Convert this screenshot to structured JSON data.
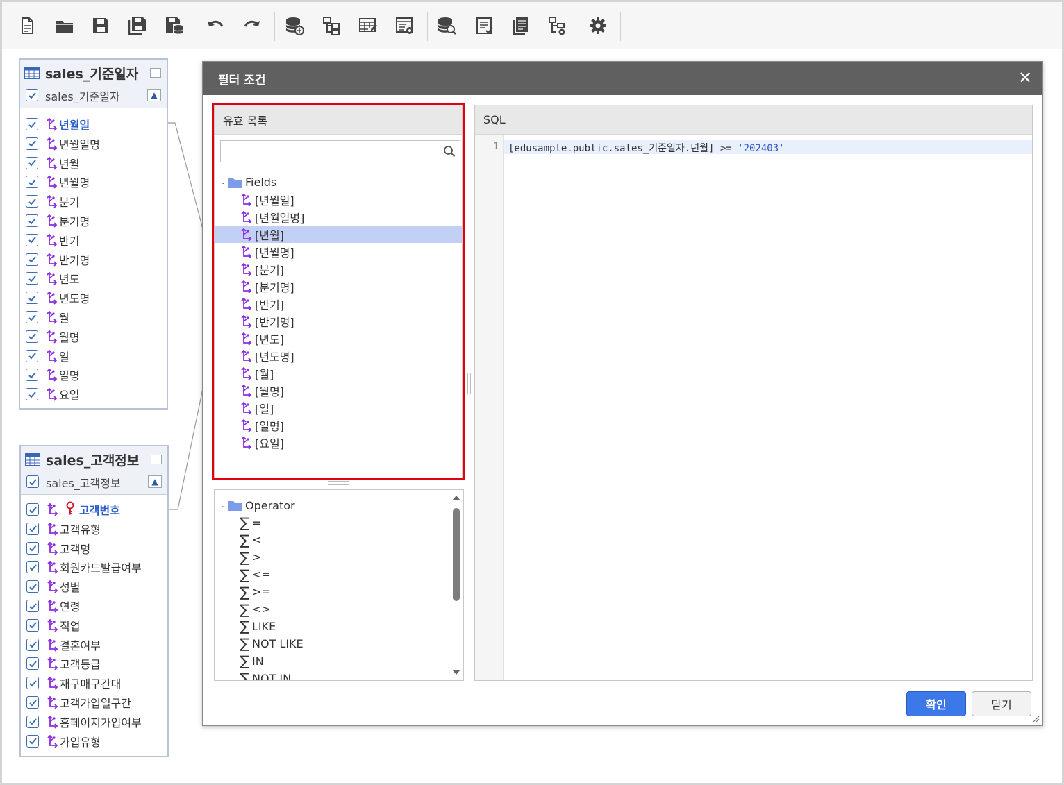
{
  "toolbar": {
    "buttons": [
      "new-document-icon",
      "open-folder-icon",
      "save-icon",
      "save-as-icon",
      "save-db-icon",
      "undo-icon",
      "redo-icon",
      "datasource-icon",
      "schema-icon",
      "table-edit-icon",
      "table-settings-icon",
      "db-search-icon",
      "query-list-icon",
      "report-icon",
      "tree-settings-icon",
      "gear-icon"
    ]
  },
  "table1": {
    "title": "sales_기준일자",
    "subtitle": "sales_기준일자",
    "fields": [
      "년월일",
      "년월일명",
      "년월",
      "년월명",
      "분기",
      "분기명",
      "반기",
      "반기명",
      "년도",
      "년도명",
      "월",
      "월명",
      "일",
      "일명",
      "요일"
    ]
  },
  "table2": {
    "title": "sales_고객정보",
    "subtitle": "sales_고객정보",
    "fields": [
      "고객번호",
      "고객유형",
      "고객명",
      "회원카드발급여부",
      "성별",
      "연령",
      "직업",
      "결혼여부",
      "고객등급",
      "재구매구간대",
      "고객가입일구간",
      "홈페이지가입여부",
      "가입유형"
    ]
  },
  "dialog": {
    "title": "필터 조건",
    "valid_list": {
      "header": "유효 목록",
      "search_placeholder": "",
      "folder": "Fields",
      "items": [
        "[년월일]",
        "[년월일명]",
        "[년월]",
        "[년월명]",
        "[분기]",
        "[분기명]",
        "[반기]",
        "[반기명]",
        "[년도]",
        "[년도명]",
        "[월]",
        "[월명]",
        "[일]",
        "[일명]",
        "[요일]"
      ],
      "selected": "[년월]"
    },
    "operator": {
      "folder": "Operator",
      "items": [
        "=",
        "<",
        ">",
        "<=",
        ">=",
        "<>",
        "LIKE",
        "NOT LIKE",
        "IN",
        "NOT IN"
      ]
    },
    "sql": {
      "header": "SQL",
      "line_number": "1",
      "code_prefix": "[edusample.public.sales_기준일자.년월] >= ",
      "code_string": "'202403'"
    },
    "ok_label": "확인",
    "close_label": "닫기"
  },
  "colors": {
    "accent": "#3d78e8",
    "highlight": "#e0000f",
    "selected_row": "#c3d0f5",
    "field_icon": "#8a2be2",
    "key_icon": "#d11a2a"
  }
}
